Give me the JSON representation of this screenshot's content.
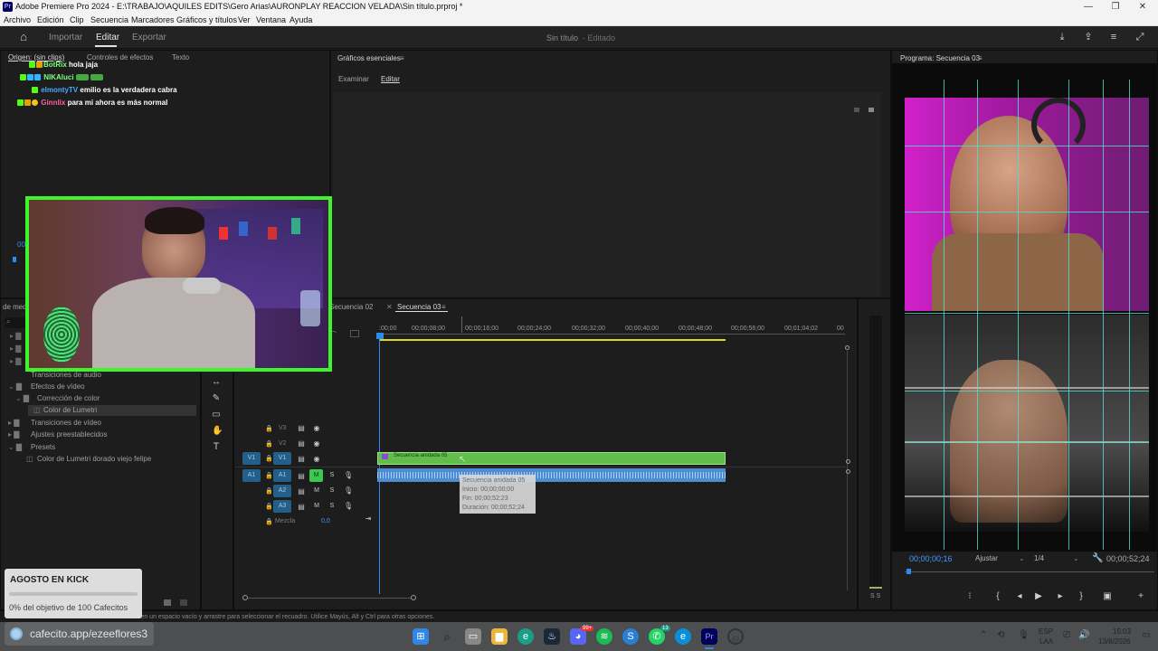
{
  "window": {
    "app_logo": "Pr",
    "title": "Adobe Premiere Pro 2024 - E:\\TRABAJO\\AQUILES EDITS\\Gero Arias\\AURONPLAY REACCION VELADA\\Sin título.prproj *"
  },
  "menu": [
    "Archivo",
    "Edición",
    "Clip",
    "Secuencia",
    "Marcadores",
    "Gráficos y títulos",
    "Ver",
    "Ventana",
    "Ayuda"
  ],
  "header": {
    "tabs": [
      "Importar",
      "Editar",
      "Exportar"
    ],
    "project_name": "Sin título",
    "project_status": "- Editado"
  },
  "source_panel": {
    "tabs": [
      "Origen: (sin clips)",
      "Controles de efectos",
      "Texto"
    ]
  },
  "chat": [
    {
      "user": "BotRix",
      "msg": "hola jaja",
      "color": "#7cff7c"
    },
    {
      "user": "NIKAluci",
      "msg": "",
      "color": "#7cff7c"
    },
    {
      "user": "elmontyTV",
      "msg": "emilio es la verdadera cabra",
      "color": "#4aa8ff"
    },
    {
      "user": "Ginnlix",
      "msg": "para mi ahora es más normal",
      "color": "#ff5fa2"
    }
  ],
  "essential_graphics": {
    "title": "Gráficos esenciales",
    "tabs": [
      "Examinar",
      "Editar"
    ]
  },
  "program_monitor": {
    "title": "Programa: Secuencia 03",
    "timecode": "00;00;00;16",
    "fit": "Ajustar",
    "quality": "1/4",
    "duration": "00;00;52;24"
  },
  "timeline": {
    "tabs": [
      "Secuencia 02",
      "Secuencia 03"
    ],
    "ruler": [
      ":00;00",
      "00;00;08;00",
      "00;00;16;00",
      "00;00;24;00",
      "00;00;32;00",
      "00;00;40;00",
      "00;00;48;00",
      "00;00;56;00",
      "00;01;04;02",
      "00"
    ],
    "video_tracks": [
      "V3",
      "V2",
      "V1"
    ],
    "audio_tracks": [
      "A1",
      "A2",
      "A3"
    ],
    "source_video": "V1",
    "source_audio": "A1",
    "mix_label": "Mezcla",
    "mix_value": "0,0",
    "clip_name": "Secuencia anidada 05",
    "tooltip": {
      "name": "Secuencia anidada 05",
      "start": "Inicio: 00;00;00;00",
      "end": "Fin: 00;00;52;23",
      "duration": "Duración: 00;00;52;24"
    }
  },
  "effects_panel": {
    "title": "de medi",
    "items": [
      "Transiciones de audio",
      "Efectos de vídeo",
      "Corrección de color",
      "Color de Lumetri",
      "Transiciones de vídeo",
      "Ajustes preestablecidos",
      "Presets",
      "Color de Lumetri dorado viejo felipe"
    ]
  },
  "status_bar": "c en un espacio vacío y arrastre para seleccionar el recuadro. Utilice Mayús, Alt y Ctrl para otras opciones.",
  "overlay": {
    "goal_title": "AGOSTO EN KICK",
    "goal_text": "0% del objetivo de 100 Cafecitos",
    "goal_progress": 0,
    "cafecito_url": "cafecito.app/ezeeflores3"
  },
  "taskbar": {
    "lang": "ESP",
    "lang2": "LAA",
    "time": "15:03",
    "date": "13/8/2026",
    "badge_discord": "99+",
    "badge_whatsapp": "13"
  },
  "colors": {
    "accent_blue": "#2d8ceb",
    "clip_green": "#5fbf4a",
    "audio_blue": "#4e8dd1",
    "webcam_border": "#3ef52b"
  }
}
